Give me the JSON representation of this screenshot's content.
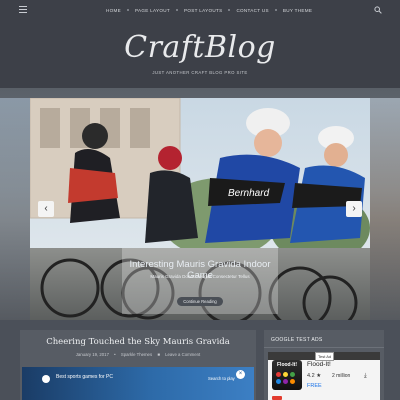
{
  "nav": {
    "items": [
      {
        "label": "Home"
      },
      {
        "label": "Page Layout"
      },
      {
        "label": "Post Layouts"
      },
      {
        "label": "Contact Us"
      },
      {
        "label": "Buy Theme"
      }
    ],
    "menu_icon": "hamburger-icon",
    "search_icon": "search-icon"
  },
  "header": {
    "logo": "CraftBlog",
    "tagline": "Just another Craft Blog Pro site"
  },
  "slider": {
    "title": "Interesting Mauris Gravida Indoor Game",
    "excerpt": "Mauris Gravida Donec Feugiat Consectetur Tellus",
    "button_label": "Continue Reading",
    "prev_icon": "chevron-left-icon",
    "next_icon": "chevron-right-icon",
    "image_icon": "cyclists-racing-photo"
  },
  "post": {
    "title": "Cheering Touched the Sky Mauris Gravida",
    "date": "January 19, 2017",
    "category": "Sparkle Themes",
    "comment": "Leave a Comment",
    "image_text": "Best sports games for PC",
    "image_button": "Search to play"
  },
  "sidebar": {
    "widget_title": "Google Test Ads",
    "ad_label": "Test Ad",
    "app_name": "Flood-It!",
    "icon_text": "Flood-It!",
    "rating": "4.2",
    "downloads": "2 million",
    "price": "FREE"
  },
  "colors": {
    "page_bg": "#4b5059",
    "header_bg": "#3d4048",
    "card_bg": "#575c64",
    "link_blue": "#1a73e8"
  }
}
